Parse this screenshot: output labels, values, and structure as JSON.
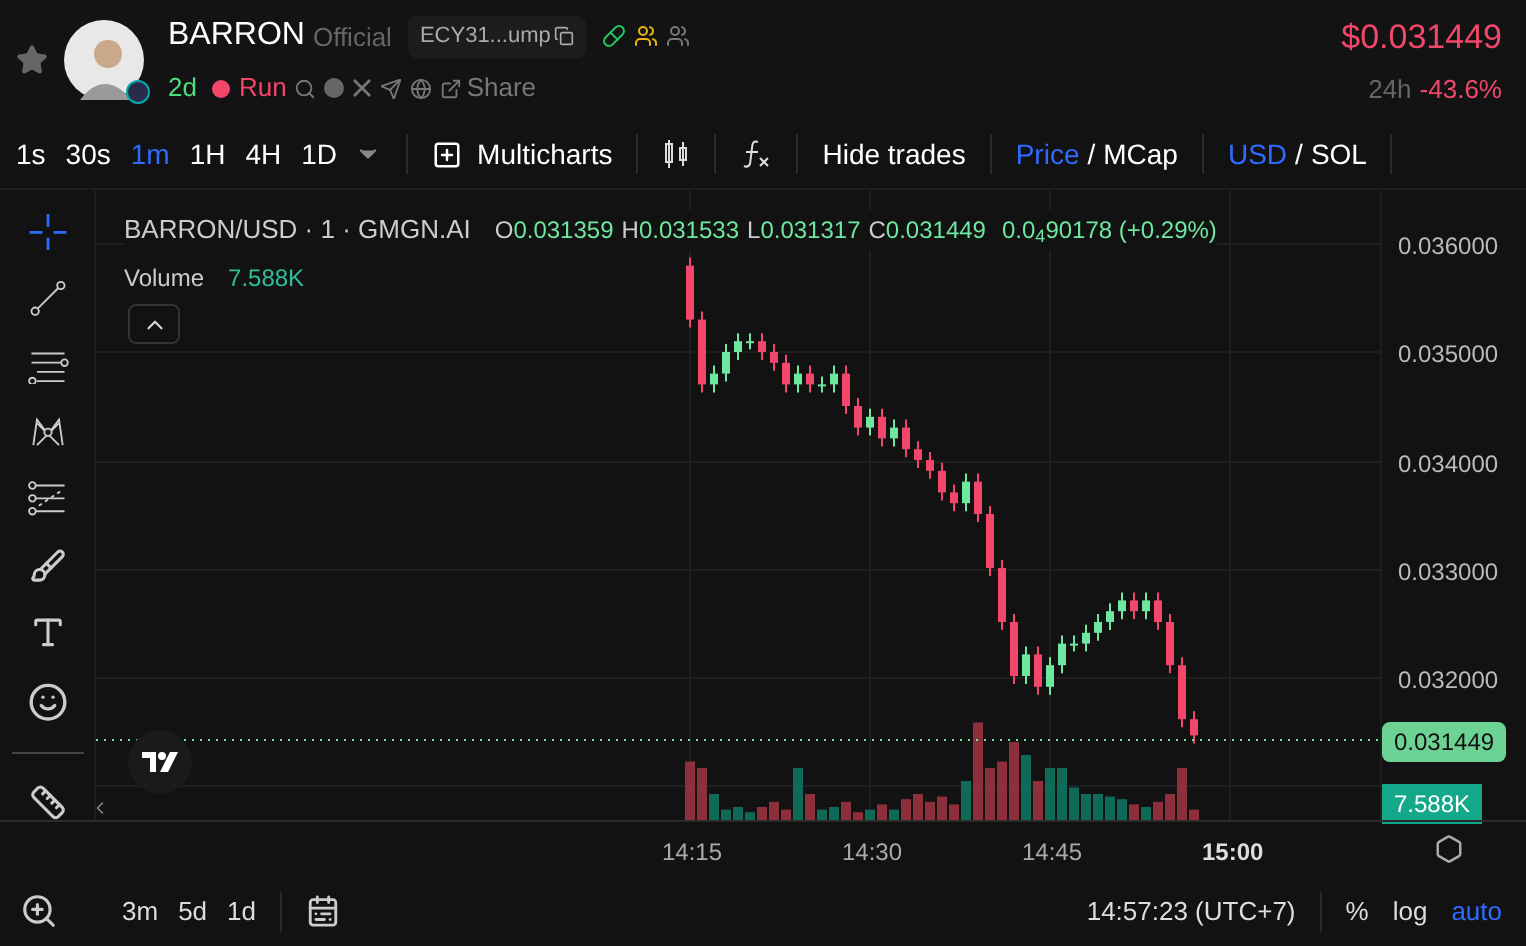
{
  "token": {
    "name": "BARRON",
    "badge": "Official",
    "address": "ECY31...ump",
    "age": "2d",
    "status": "Run",
    "share": "Share"
  },
  "price": {
    "value": "$0.031449",
    "period": "24h",
    "change": "-43.6%"
  },
  "toolbar": {
    "intervals": [
      {
        "label": "1s",
        "selected": false
      },
      {
        "label": "30s",
        "selected": false
      },
      {
        "label": "1m",
        "selected": true
      },
      {
        "label": "1H",
        "selected": false
      },
      {
        "label": "4H",
        "selected": false
      },
      {
        "label": "1D",
        "selected": false
      }
    ],
    "multicharts": "Multicharts",
    "separator": "/",
    "hide_trades": "Hide trades",
    "price_mode": [
      {
        "label": "Price",
        "selected": true
      },
      {
        "label": "MCap",
        "selected": false
      }
    ],
    "currency": [
      {
        "label": "USD",
        "selected": true
      },
      {
        "label": "SOL",
        "selected": false
      }
    ]
  },
  "legend": {
    "title": "BARRON/USD · 1 · GMGN.AI",
    "values": [
      {
        "key": "O",
        "value": "0.031359"
      },
      {
        "key": "H",
        "value": "0.031533"
      },
      {
        "key": "L",
        "value": "0.031317"
      },
      {
        "key": "C",
        "value": "0.031449"
      }
    ],
    "change": "0.0$_{4}$90178 (+0.29%)",
    "volume_label": "Volume",
    "volume_value": "7.588K"
  },
  "price_axis": {
    "ticks": [
      "0.036000",
      "0.035000",
      "0.034000",
      "0.033000",
      "0.032000"
    ],
    "last_price": "0.031449",
    "volume_badge": "7.588K"
  },
  "time_axis": [
    {
      "label": "14:15",
      "major": false
    },
    {
      "label": "14:30",
      "major": false
    },
    {
      "label": "14:45",
      "major": false
    },
    {
      "label": "15:00",
      "major": true
    }
  ],
  "bottom_bar": {
    "ranges": [
      "3m",
      "5d",
      "1d"
    ],
    "clock": "14:57:23 (UTC+7)",
    "scales": [
      {
        "label": "%",
        "selected": false
      },
      {
        "label": "log",
        "selected": false
      },
      {
        "label": "auto",
        "selected": true
      }
    ]
  }
}
